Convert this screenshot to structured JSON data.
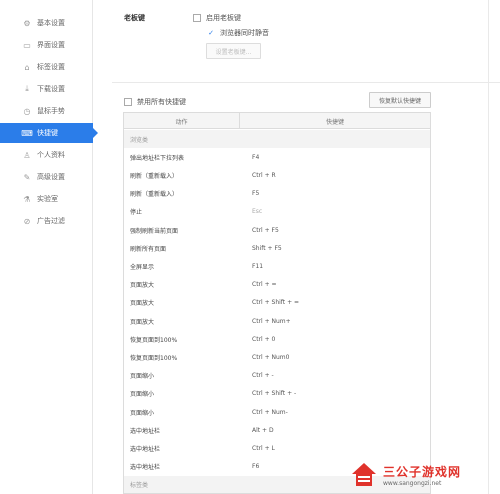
{
  "sidebar": {
    "items": [
      {
        "label": "基本设置",
        "icon": "gear-icon",
        "glyph": "⚙"
      },
      {
        "label": "界面设置",
        "icon": "window-icon",
        "glyph": "▭"
      },
      {
        "label": "标签设置",
        "icon": "tag-icon",
        "glyph": "⌂"
      },
      {
        "label": "下载设置",
        "icon": "download-icon",
        "glyph": "⤓"
      },
      {
        "label": "鼠标手势",
        "icon": "mouse-icon",
        "glyph": "◷"
      },
      {
        "label": "快捷键",
        "icon": "keyboard-icon",
        "glyph": "⌨"
      },
      {
        "label": "个人资料",
        "icon": "user-icon",
        "glyph": "♙"
      },
      {
        "label": "高级设置",
        "icon": "wrench-icon",
        "glyph": "✎"
      },
      {
        "label": "实验室",
        "icon": "flask-icon",
        "glyph": "⚗"
      },
      {
        "label": "广告过滤",
        "icon": "block-icon",
        "glyph": "⊘"
      }
    ],
    "active_index": 5,
    "accent_color": "#2b7de9"
  },
  "boss_key": {
    "label": "老板键",
    "enable_label": "启用老板键",
    "enable_checked": false,
    "mute_label": "浏览器同时静音",
    "mute_checked": true,
    "set_button": "设置老板键..."
  },
  "shortcuts": {
    "disable_all_label": "禁用所有快捷键",
    "disable_all_checked": false,
    "restore_button": "恢复默认快捷键",
    "columns": {
      "action": "动作",
      "key": "快捷键"
    },
    "rows": [
      {
        "type": "group",
        "action": "浏览类",
        "key": ""
      },
      {
        "type": "item",
        "action": "弹出地址栏下拉列表",
        "key": "F4"
      },
      {
        "type": "item",
        "action": "刷新（重新载入）",
        "key": "Ctrl + R"
      },
      {
        "type": "item",
        "action": "刷新（重新载入）",
        "key": "F5"
      },
      {
        "type": "item",
        "action": "停止",
        "key": "Esc",
        "dim": true
      },
      {
        "type": "item",
        "action": "强制刷新当前页面",
        "key": "Ctrl + F5"
      },
      {
        "type": "item",
        "action": "刷新所有页面",
        "key": "Shift + F5"
      },
      {
        "type": "item",
        "action": "全屏显示",
        "key": "F11"
      },
      {
        "type": "item",
        "action": "页面放大",
        "key": "Ctrl + ="
      },
      {
        "type": "item",
        "action": "页面放大",
        "key": "Ctrl + Shift + ="
      },
      {
        "type": "item",
        "action": "页面放大",
        "key": "Ctrl + Num+"
      },
      {
        "type": "item",
        "action": "恢复页面到100%",
        "key": "Ctrl + 0"
      },
      {
        "type": "item",
        "action": "恢复页面到100%",
        "key": "Ctrl + Num0"
      },
      {
        "type": "item",
        "action": "页面缩小",
        "key": "Ctrl + -"
      },
      {
        "type": "item",
        "action": "页面缩小",
        "key": "Ctrl + Shift + -"
      },
      {
        "type": "item",
        "action": "页面缩小",
        "key": "Ctrl + Num-"
      },
      {
        "type": "item",
        "action": "选中地址栏",
        "key": "Alt + D"
      },
      {
        "type": "item",
        "action": "选中地址栏",
        "key": "Ctrl + L"
      },
      {
        "type": "item",
        "action": "选中地址栏",
        "key": "F6"
      },
      {
        "type": "group",
        "action": "标签类",
        "key": ""
      }
    ]
  },
  "watermark": {
    "title": "三公子游戏网",
    "url": "www.sangongzi.net",
    "color": "#e0322b"
  }
}
